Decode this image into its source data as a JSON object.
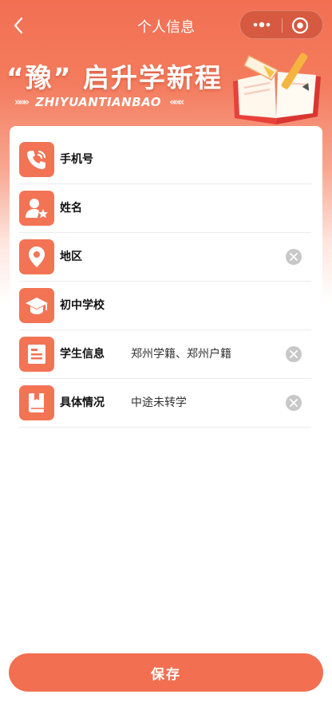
{
  "navbar": {
    "title": "个人信息",
    "back_icon": "chevron-left-icon",
    "more_icon": "more-dots-icon",
    "close_icon": "target-circle-icon"
  },
  "banner": {
    "title": "“豫” 启升学新程",
    "subtitle": "ZHIYUANTIANBAO",
    "chevrons_left": "»»»",
    "chevrons_right": "«««"
  },
  "form": {
    "rows": [
      {
        "label": "手机号",
        "value": "",
        "icon": "phone-icon",
        "clearable": false
      },
      {
        "label": "姓名",
        "value": "",
        "icon": "user-star-icon",
        "clearable": false
      },
      {
        "label": "地区",
        "value": "",
        "icon": "location-pin-icon",
        "clearable": true
      },
      {
        "label": "初中学校",
        "value": "",
        "icon": "graduation-cap-icon",
        "clearable": false
      },
      {
        "label": "学生信息",
        "value": "郑州学籍、郑州户籍",
        "icon": "id-card-icon",
        "clearable": true
      },
      {
        "label": "具体情况",
        "value": "中途未转学",
        "icon": "book-icon",
        "clearable": true
      }
    ]
  },
  "footer": {
    "save_label": "保存"
  },
  "colors": {
    "accent": "#f26f52",
    "clear_grey": "#c8c8c8"
  }
}
